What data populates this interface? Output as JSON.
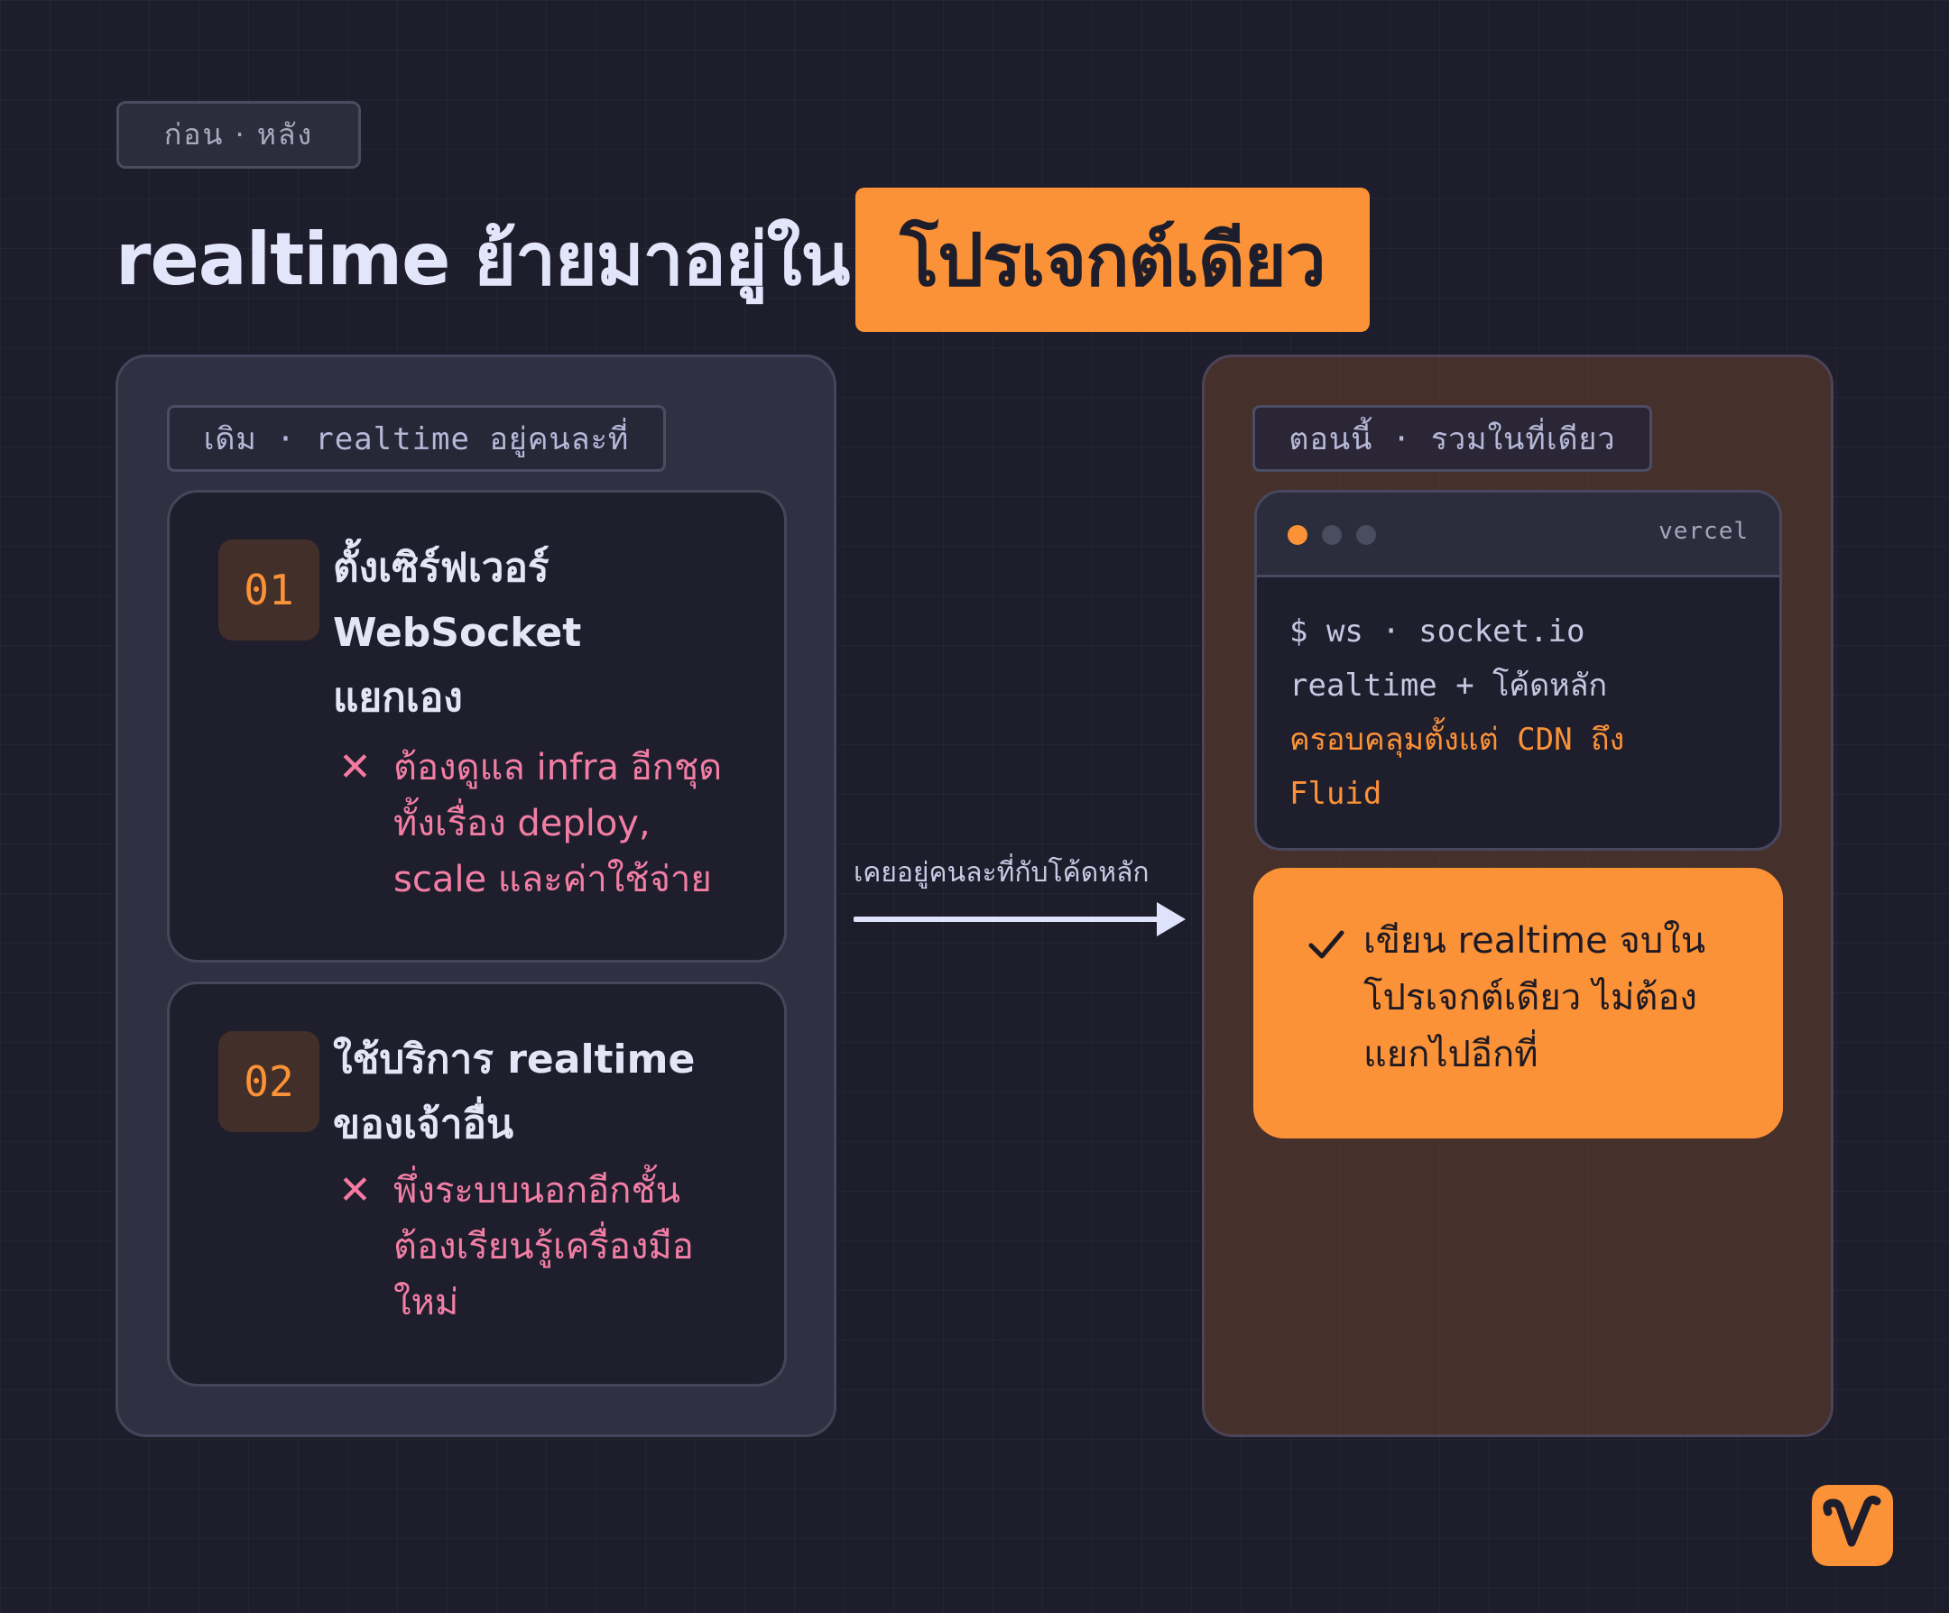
{
  "header": {
    "tag": "ก่อน · หลัง",
    "title": "realtime ย้ายมาอยู่ใน",
    "title_highlight": "โปรเจกต์เดียว"
  },
  "before": {
    "chip": "เดิม · realtime อยู่คนละที่",
    "items": [
      {
        "number": "01",
        "title_lines": [
          "ตั้งเซิร์ฟเวอร์",
          "WebSocket",
          "แยกเอง"
        ],
        "cons_lines": [
          "ต้องดูแล infra อีกชุด",
          "ทั้งเรื่อง deploy,",
          "scale และค่าใช้จ่าย"
        ]
      },
      {
        "number": "02",
        "title_lines": [
          "ใช้บริการ realtime",
          "ของเจ้าอื่น"
        ],
        "cons_lines": [
          "พึ่งระบบนอกอีกชั้น",
          "ต้องเรียนรู้เครื่องมือ",
          "ใหม่"
        ]
      }
    ],
    "cross_symbol": "✕"
  },
  "transition": {
    "label": "เคยอยู่คนละที่กับโค้ดหลัก"
  },
  "after": {
    "chip": "ตอนนี้ · รวมในที่เดียว",
    "window": {
      "host": "vercel",
      "lines": [
        "$ ws · socket.io",
        "realtime + โค้ดหลัก"
      ],
      "highlight_lines": [
        "ครอบคลุมตั้งแต่ CDN ถึง",
        "Fluid"
      ]
    },
    "benefit_lines": [
      "เขียน realtime จบใน",
      "โปรเจกต์เดียว ไม่ต้อง",
      "แยกไปอีกที่"
    ]
  },
  "colors": {
    "background": "#1d1d2b",
    "accent": "#fb9237",
    "negative": "#f27ea4",
    "text": "#e3e5fb"
  },
  "icons": {
    "cross": "x-icon",
    "check": "check-icon",
    "arrow": "arrow-right-icon",
    "logo": "v-logo-icon"
  }
}
